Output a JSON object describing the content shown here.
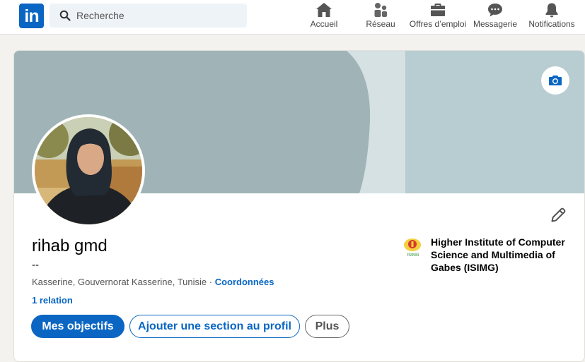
{
  "nav": {
    "logo_text": "in",
    "search_placeholder": "Recherche",
    "items": [
      {
        "label": "Accueil",
        "icon": "home-icon"
      },
      {
        "label": "Réseau",
        "icon": "network-icon"
      },
      {
        "label": "Offres d’emploi",
        "icon": "briefcase-icon"
      },
      {
        "label": "Messagerie",
        "icon": "messaging-icon"
      },
      {
        "label": "Notifications",
        "icon": "bell-icon"
      }
    ]
  },
  "profile": {
    "name": "rihab gmd",
    "headline": "--",
    "location": "Kasserine, Gouvernorat Kasserine, Tunisie",
    "separator": " · ",
    "contact_link": "Coordonnées",
    "connections": "1 relation",
    "buttons": {
      "primary": "Mes objectifs",
      "add_section": "Ajouter une section au profil",
      "more": "Plus"
    },
    "school": {
      "name": "Higher Institute of Computer Science and Multimedia of Gabes (ISIMG)",
      "logo_text": "ISIMG"
    }
  },
  "colors": {
    "brand": "#0a66c2",
    "cover_dark": "#a0b4b7",
    "cover_light": "#b7cdd1"
  }
}
